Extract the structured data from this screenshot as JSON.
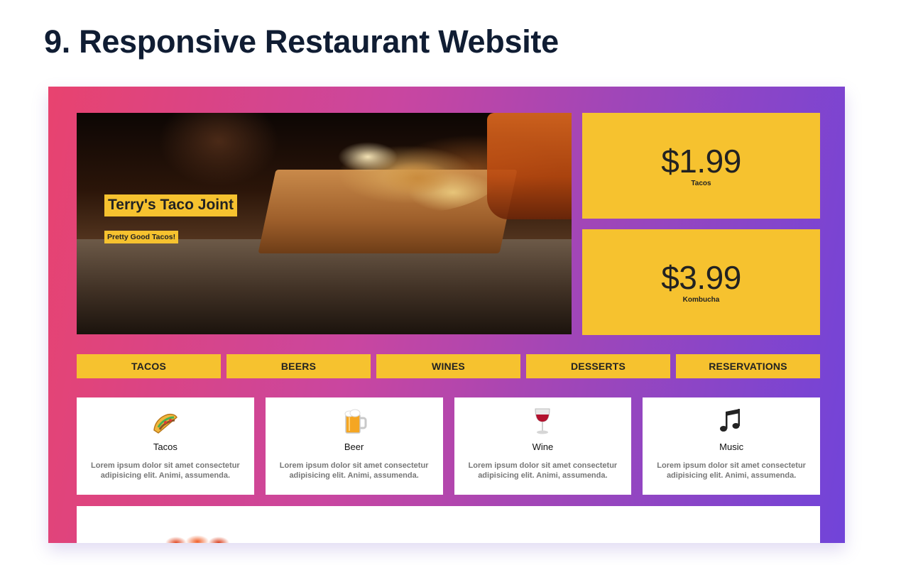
{
  "page": {
    "title": "9. Responsive Restaurant Website"
  },
  "hero": {
    "title": "Terry's Taco Joint",
    "subtitle": "Pretty Good Tacos!"
  },
  "prices": [
    {
      "amount": "$1.99",
      "label": "Tacos"
    },
    {
      "amount": "$3.99",
      "label": "Kombucha"
    }
  ],
  "menu": {
    "items": [
      "TACOS",
      "BEERS",
      "WINES",
      "DESSERTS",
      "RESERVATIONS"
    ]
  },
  "cards": [
    {
      "icon": "taco-icon",
      "name": "Tacos",
      "text": "Lorem ipsum dolor sit amet consectetur adipisicing elit. Animi, assumenda."
    },
    {
      "icon": "beer-mug-icon",
      "name": "Beer",
      "text": "Lorem ipsum dolor sit amet consectetur adipisicing elit. Animi, assumenda."
    },
    {
      "icon": "wine-glass-icon",
      "name": "Wine",
      "text": "Lorem ipsum dolor sit amet consectetur adipisicing elit. Animi, assumenda."
    },
    {
      "icon": "music-notes-icon",
      "name": "Music",
      "text": "Lorem ipsum dolor sit amet consectetur adipisicing elit. Animi, assumenda."
    }
  ],
  "colors": {
    "accent": "#f6c22f",
    "gradient_start": "#e8436f",
    "gradient_end": "#7144d9",
    "title": "#101d33"
  }
}
